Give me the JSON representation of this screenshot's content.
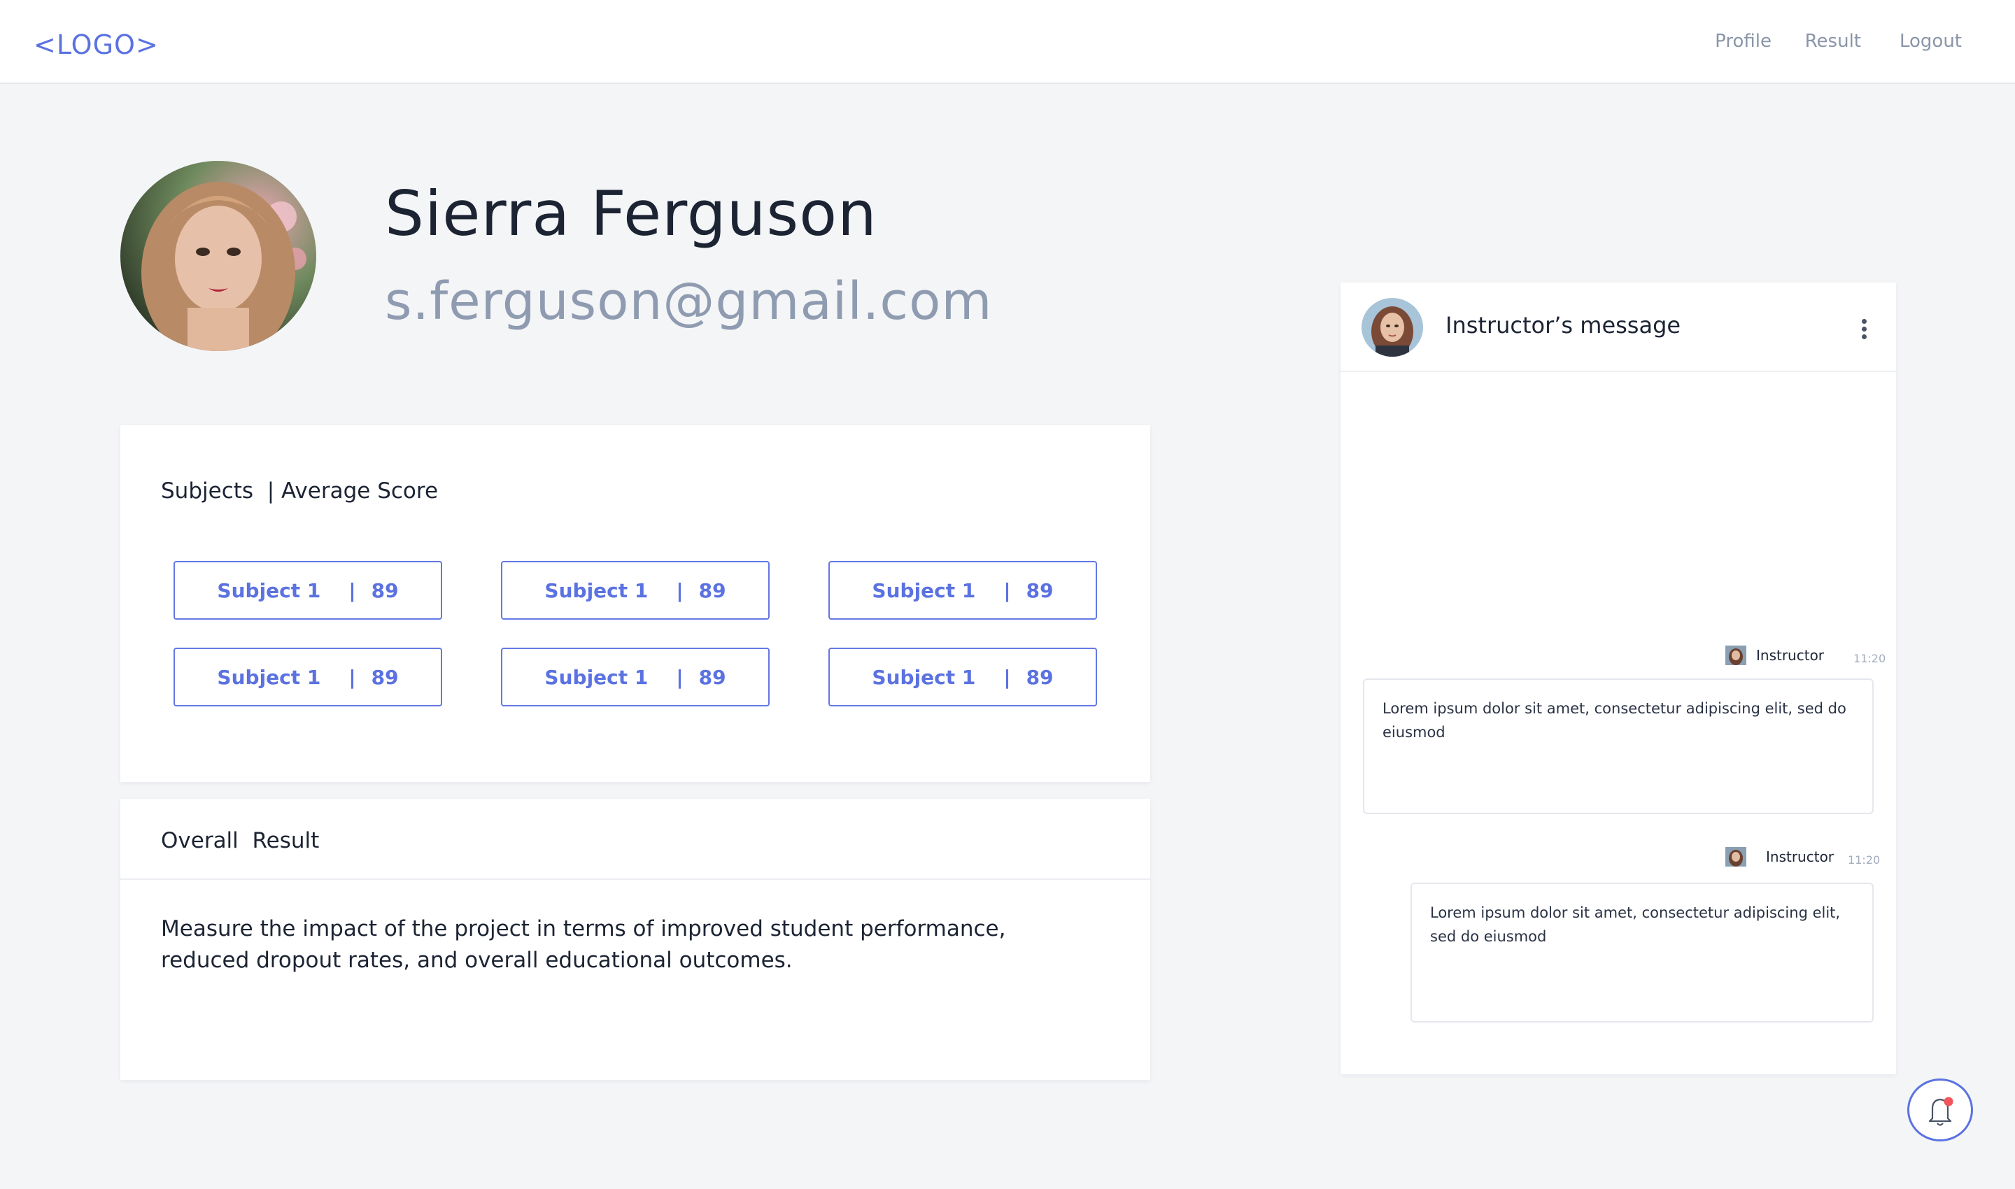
{
  "header": {
    "logo": "<LOGO>",
    "nav": [
      {
        "label": "Profile"
      },
      {
        "label": "Result"
      },
      {
        "label": "Logout"
      }
    ]
  },
  "profile": {
    "name": "Sierra Ferguson",
    "email": "s.ferguson@gmail.com"
  },
  "subjects": {
    "title": "Subjects  | Average Score",
    "items": [
      {
        "name": "Subject 1",
        "score": "89"
      },
      {
        "name": "Subject 1",
        "score": "89"
      },
      {
        "name": "Subject 1",
        "score": "89"
      },
      {
        "name": "Subject 1",
        "score": "89"
      },
      {
        "name": "Subject 1",
        "score": "89"
      },
      {
        "name": "Subject 1",
        "score": "89"
      }
    ]
  },
  "overall": {
    "title": "Overall  Result",
    "text": "Measure the impact of the project in terms of improved student performance, reduced dropout rates, and overall educational outcomes."
  },
  "chat": {
    "title": "Instructor’s message",
    "messages": [
      {
        "sender": "Instructor",
        "time": "11:20",
        "text": "Lorem ipsum dolor sit amet, consectetur adipiscing elit, sed do eiusmod"
      },
      {
        "sender": "Instructor",
        "time": "11:20",
        "text": "Lorem ipsum dolor sit amet, consectetur adipiscing elit, sed do eiusmod"
      }
    ]
  },
  "icons": {
    "more": "kebab-menu-icon",
    "notification": "bell-icon"
  },
  "colors": {
    "accent": "#5b72e0",
    "notification_dot": "#f2545b",
    "background": "#f4f5f7"
  }
}
